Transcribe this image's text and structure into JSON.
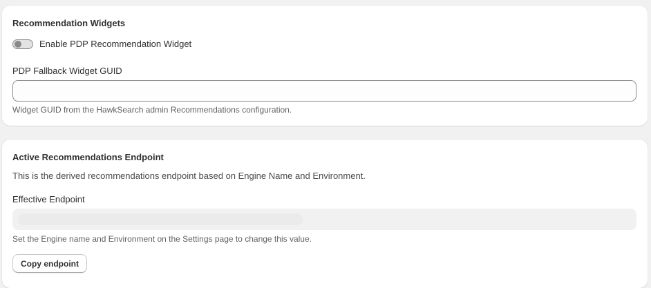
{
  "widgets_card": {
    "title": "Recommendation Widgets",
    "toggle": {
      "label": "Enable PDP Recommendation Widget",
      "enabled": false
    },
    "fallback_field": {
      "label": "PDP Fallback Widget GUID",
      "value": "",
      "placeholder": "",
      "help": "Widget GUID from the HawkSearch admin Recommendations configuration."
    }
  },
  "endpoint_card": {
    "title": "Active Recommendations Endpoint",
    "description": "This is the derived recommendations endpoint based on Engine Name and Environment.",
    "effective_field": {
      "label": "Effective Endpoint",
      "value": "",
      "help": "Set the Engine name and Environment on the Settings page to change this value."
    },
    "copy_button_label": "Copy endpoint"
  }
}
